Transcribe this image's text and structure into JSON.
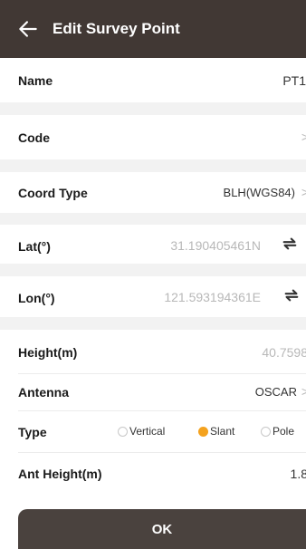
{
  "header": {
    "title": "Edit Survey Point"
  },
  "fields": {
    "name": {
      "label": "Name",
      "value": "PT1"
    },
    "code": {
      "label": "Code",
      "chevron": ">"
    },
    "coord_type": {
      "label": "Coord Type",
      "value": "BLH(WGS84)",
      "chevron": ">"
    },
    "lat": {
      "label": "Lat(°)",
      "value": "31.190405461N",
      "icon": "swap-icon"
    },
    "lon": {
      "label": "Lon(°)",
      "value": "121.593194361E",
      "icon": "swap-icon"
    },
    "height": {
      "label": "Height(m)",
      "value": "40.7598"
    },
    "antenna": {
      "label": "Antenna",
      "value": "OSCAR",
      "chevron": ">"
    },
    "type": {
      "label": "Type",
      "options": [
        "Vertical",
        "Slant",
        "Pole"
      ],
      "selected": "Slant"
    },
    "ant_height": {
      "label": "Ant Height(m)",
      "value": "1.8"
    }
  },
  "footer": {
    "ok_label": "OK"
  },
  "colors": {
    "appbar": "#413834",
    "accent": "#f4a21e",
    "button": "#4a423e"
  }
}
